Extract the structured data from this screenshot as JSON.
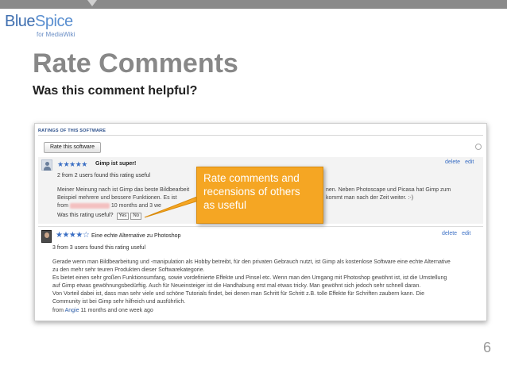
{
  "logo": {
    "name_a": "Blue",
    "name_b": "Spice",
    "tagline": "for MediaWiki"
  },
  "slide": {
    "title": "Rate Comments",
    "subtitle": "Was this comment helpful?",
    "page_number": "6"
  },
  "callout": {
    "text_lines": [
      "Rate comments and",
      "recensions of others",
      "as useful"
    ],
    "color": "#f5a623"
  },
  "ratings": {
    "header": "RATINGS OF THIS SOFTWARE",
    "rate_button": "Rate this software",
    "items": [
      {
        "stars": 5,
        "stars_glyph": "★★★★★",
        "title": "Gimp ist super!",
        "count_text": "2 from 2 users found this rating useful",
        "body_lines": [
          "Meiner Meinung nach ist Gimp das beste Bildbearbeit",
          "Beispiel mehrere und bessere Funktionen. Es ist",
          "nen. Neben Photoscape und Picasa hat Gimp zum",
          "kommt man nach der Zeit weiter. :-)"
        ],
        "from_prefix": "from",
        "time": "10 months and 3 we",
        "helpful_label": "Was this rating useful?",
        "yes": "Yes",
        "no": "No",
        "delete": "delete",
        "edit": "edit"
      },
      {
        "stars": 4,
        "stars_glyph": "★★★★☆",
        "title": "Eine echte Alternative zu Photoshop",
        "count_text": "3 from 3 users found this rating useful",
        "body_lines": [
          "Gerade wenn man Bildbearbeitung und -manipulation als Hobby betreibt, für den privaten Gebrauch nutzt, ist Gimp als kostenlose Software eine echte Alternative",
          "zu den mehr sehr teuren Produkten dieser Softwarekategorie.",
          "Es bietet einen sehr großen Funktionsumfang, sowie vordefinierte Effekte und Pinsel etc. Wenn man den Umgang mit Photoshop gewöhnt ist, ist die Umstellung",
          "auf Gimp etwas gewöhnungsbedürftig. Auch für Neueinsteiger ist die Handhabung erst mal etwas tricky. Man gewöhnt sich jedoch sehr schnell daran.",
          "Von Vorteil dabei ist, dass man sehr viele und schöne Tutorials findet, bei denen man Schritt für Schritt z.B. tolle Effekte für Schriften zaubern kann. Die",
          "Community ist bei Gimp sehr hilfreich und ausführlich."
        ],
        "from_prefix": "from",
        "user": "Angie",
        "time": "11 months and one week ago",
        "delete": "delete",
        "edit": "edit"
      }
    ]
  }
}
